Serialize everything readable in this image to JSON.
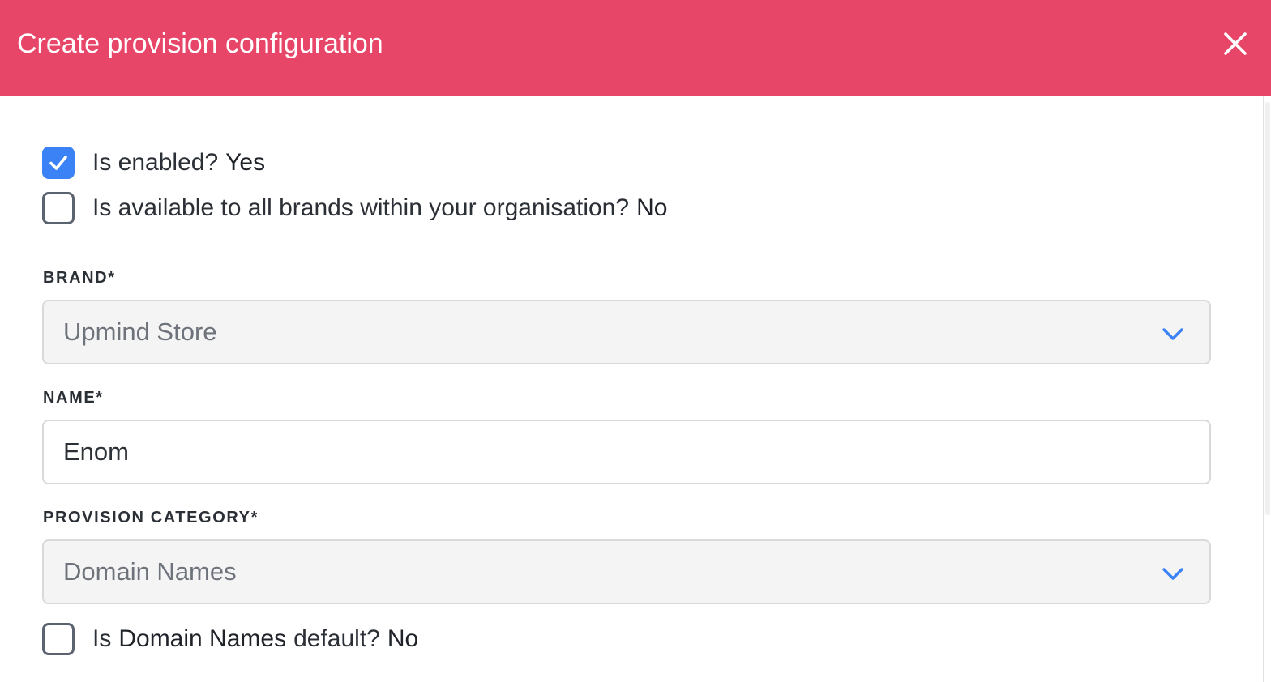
{
  "dialog": {
    "title": "Create provision configuration",
    "close_icon": "close-icon",
    "header_color": "#e84668"
  },
  "form": {
    "is_enabled": {
      "label": "Is enabled?",
      "value": "Yes",
      "checked": true
    },
    "all_brands": {
      "label": "Is available to all brands within your organisation?",
      "value": "No",
      "checked": false
    },
    "brand": {
      "label": "BRAND*",
      "value": "Upmind Store",
      "icon": "chevron-down-icon"
    },
    "name": {
      "label": "NAME*",
      "value": "Enom"
    },
    "provision_category": {
      "label": "PROVISION CATEGORY*",
      "value": "Domain Names",
      "icon": "chevron-down-icon"
    },
    "category_default": {
      "prefix": "Is",
      "category": "Domain Names",
      "suffix": "default?",
      "value": "No",
      "checked": false
    }
  },
  "colors": {
    "accent": "#3b82f6",
    "header": "#e84668"
  }
}
